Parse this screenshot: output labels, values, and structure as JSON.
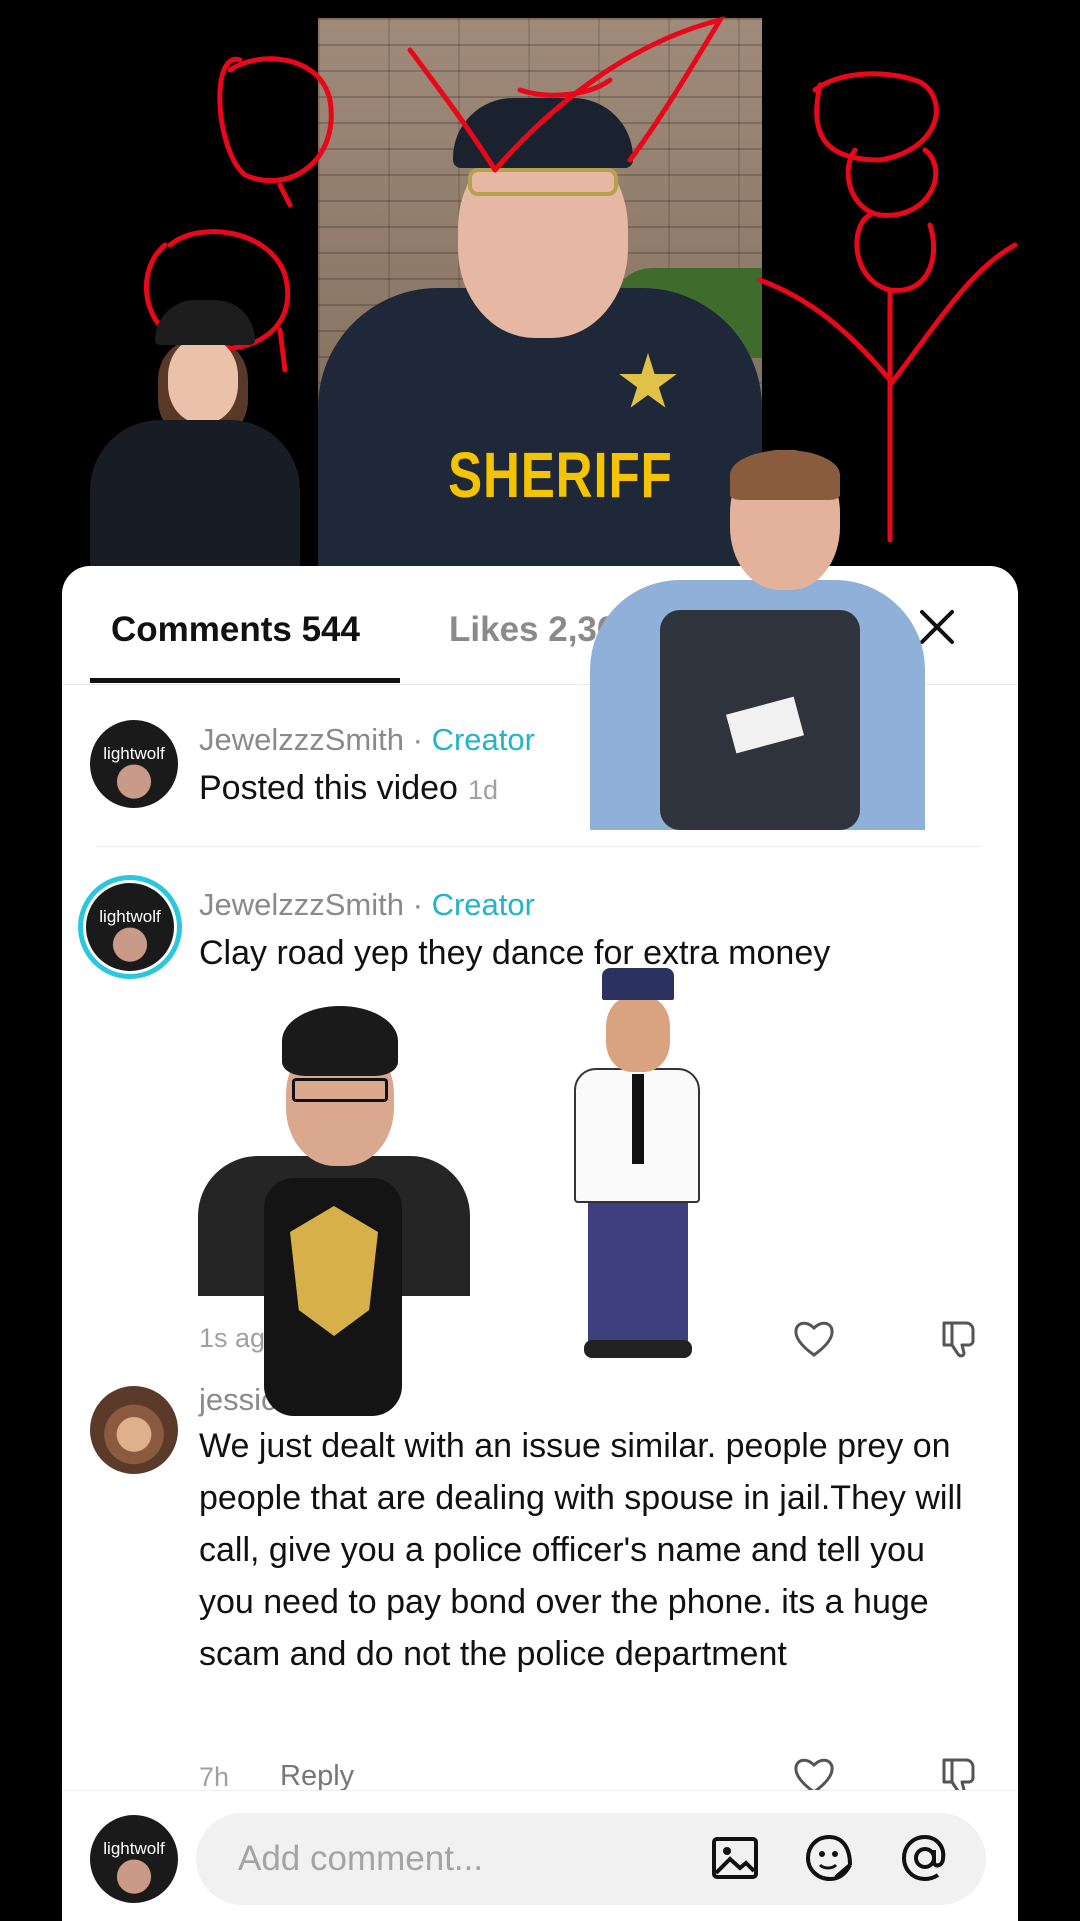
{
  "video": {
    "vest_text": "SHERIFF"
  },
  "tabs": {
    "comments_label": "Comments 544",
    "likes_label": "Likes 2,363"
  },
  "comments": [
    {
      "username": "JewelzzzSmith",
      "separator": " · ",
      "creator_tag": "Creator",
      "text": "Posted this video",
      "timestamp": "1d",
      "avatar_text": "lightwolf"
    },
    {
      "username": "JewelzzzSmith",
      "separator": " · ",
      "creator_tag": "Creator",
      "text": "Clay road yep they dance for extra money",
      "timestamp": "1s ago",
      "avatar_text": "lightwolf"
    },
    {
      "username": "jessica walker",
      "text": "We just dealt with an issue similar. people prey on people that are dealing with spouse in jail.They will call, give you a police officer's name and tell you you need to pay bond over the phone. its a huge scam and do not the police department",
      "timestamp": "7h",
      "reply_label": "Reply"
    }
  ],
  "composer": {
    "placeholder": "Add comment...",
    "avatar_text": "lightwolf"
  },
  "colors": {
    "creator_accent": "#22b5c8",
    "doodle_red": "#e8081a",
    "avatar_ring": "#2bc7dc"
  }
}
